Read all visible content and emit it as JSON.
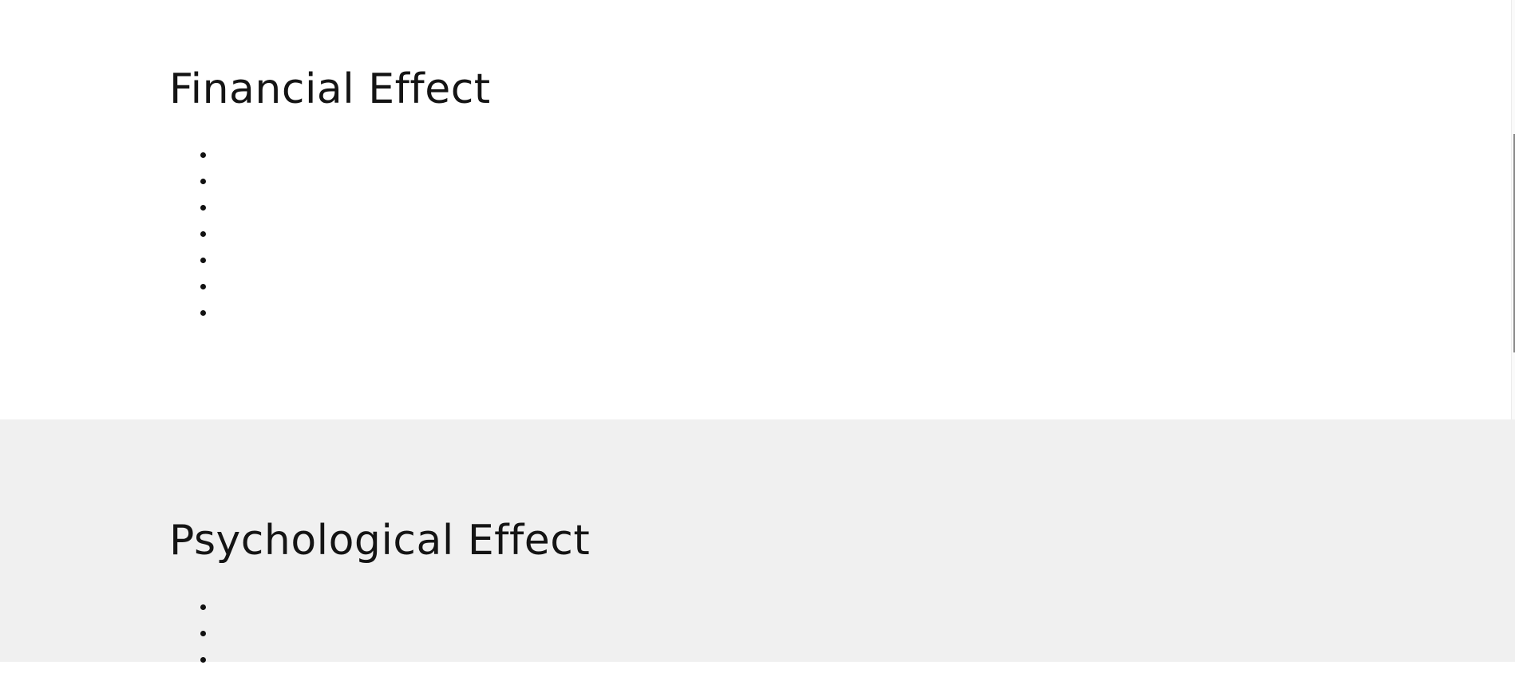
{
  "financial": {
    "title": "Financial Effect",
    "items": [
      "",
      "",
      "",
      "",
      "",
      "",
      ""
    ]
  },
  "psychological": {
    "title": "Psychological Effect",
    "items": [
      "",
      "",
      ""
    ]
  }
}
